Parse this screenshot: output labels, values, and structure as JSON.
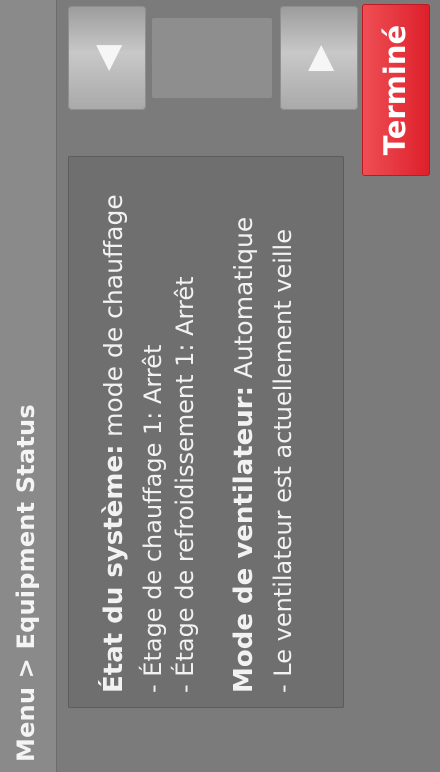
{
  "breadcrumb": {
    "text": "Menu > Equipment Status"
  },
  "system_state": {
    "label": "État du système:",
    "value": "mode de chauffage",
    "heating_stage": "- Étage de chauffage 1: Arrêt",
    "cooling_stage": "- Étage de refroidissement 1: Arrêt"
  },
  "fan_mode": {
    "label": "Mode de ventilateur:",
    "value": "Automatique",
    "status": "- Le ventilateur est actuellement veille"
  },
  "nav": {
    "up_icon": "triangle-left-icon",
    "down_icon": "triangle-right-icon"
  },
  "done_button": {
    "label": "Terminé",
    "color": "#e0222d"
  },
  "colors": {
    "background": "#7b7b7b",
    "panel": "#6f6f6f",
    "text": "#f2f2f2"
  }
}
